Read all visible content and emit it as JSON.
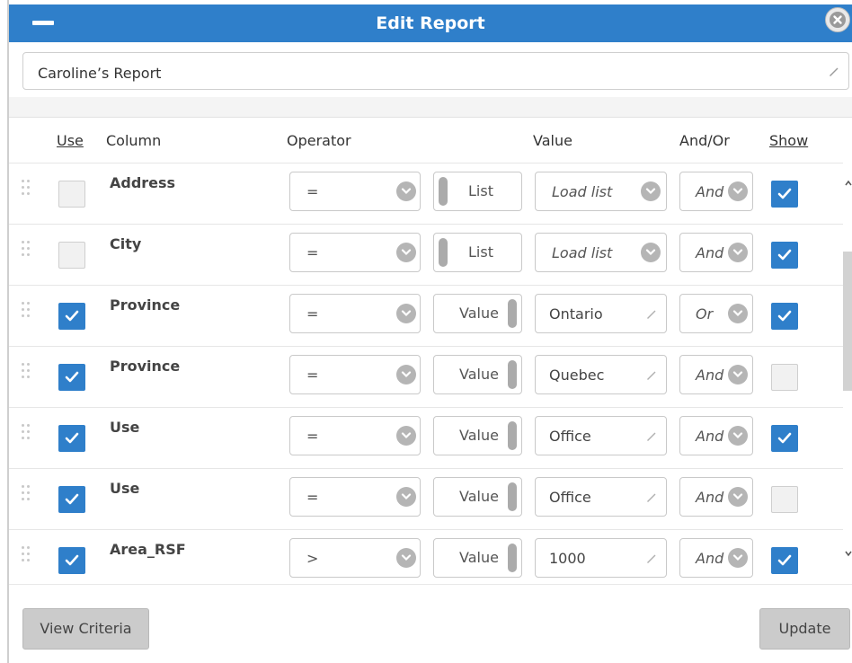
{
  "window": {
    "title": "Edit Report"
  },
  "report_name": "Caroline’s Report",
  "headers": {
    "use": "Use",
    "column": "Column",
    "operator": "Operator",
    "value": "Value",
    "andor": "And/Or",
    "show": "Show"
  },
  "rows": [
    {
      "use": false,
      "column": "Address",
      "operator": "=",
      "mode": "List",
      "value": "Load list",
      "value_type": "list",
      "andor": "And",
      "show": true
    },
    {
      "use": false,
      "column": "City",
      "operator": "=",
      "mode": "List",
      "value": "Load list",
      "value_type": "list",
      "andor": "And",
      "show": true
    },
    {
      "use": true,
      "column": "Province",
      "operator": "=",
      "mode": "Value",
      "value": "Ontario",
      "value_type": "text",
      "andor": "Or",
      "show": true
    },
    {
      "use": true,
      "column": "Province",
      "operator": "=",
      "mode": "Value",
      "value": "Quebec",
      "value_type": "text",
      "andor": "And",
      "show": false
    },
    {
      "use": true,
      "column": "Use",
      "operator": "=",
      "mode": "Value",
      "value": "Office",
      "value_type": "text",
      "andor": "And",
      "show": true
    },
    {
      "use": true,
      "column": "Use",
      "operator": "=",
      "mode": "Value",
      "value": "Office",
      "value_type": "text",
      "andor": "And",
      "show": false
    },
    {
      "use": true,
      "column": "Area_RSF",
      "operator": ">",
      "mode": "Value",
      "value": "1000",
      "value_type": "text",
      "andor": "And",
      "show": true
    }
  ],
  "buttons": {
    "view_criteria": "View Criteria",
    "update": "Update"
  },
  "colors": {
    "accent": "#2f7fca",
    "button": "#cbcbcb"
  },
  "icons": {
    "minimize": "minimize-icon",
    "close": "close-icon",
    "pencil": "pencil-icon",
    "chevron": "chevron-down-icon",
    "grip": "drag-handle-icon"
  }
}
